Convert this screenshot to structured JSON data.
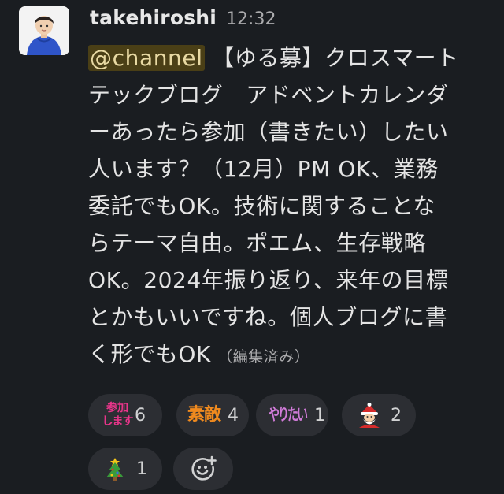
{
  "message": {
    "author": "takehiroshi",
    "time": "12:32",
    "mention": "@channel",
    "lines": [
      "【ゆる募】クロスマート",
      "テックブログ　アドベントカレンダ",
      "ーあったら参加（書きたい）したい",
      "人います？（12月）PM OK、業務",
      "委託でもOK。技術に関することな",
      "らテーマ自由。ポエム、生存戦略",
      "OK。2024年振り返り、来年の目標",
      "とかもいいですね。個人ブログに書",
      "く形でもOK"
    ],
    "edited_label": "（編集済み）"
  },
  "reactions": [
    {
      "emoji": "sanka-shimasu",
      "text_top": "参加",
      "text_bottom": "します",
      "count": "6",
      "color": "#e8358a"
    },
    {
      "emoji": "suteki",
      "text": "素敵",
      "count": "4",
      "color": "#f08a1e"
    },
    {
      "emoji": "yaritai",
      "text": "やりたい",
      "count": "1",
      "color": "#d07bd8"
    },
    {
      "emoji": "santa",
      "count": "2"
    },
    {
      "emoji": "christmas-tree",
      "count": "1"
    }
  ],
  "add_reaction": {
    "icon": "add-reaction-icon"
  }
}
